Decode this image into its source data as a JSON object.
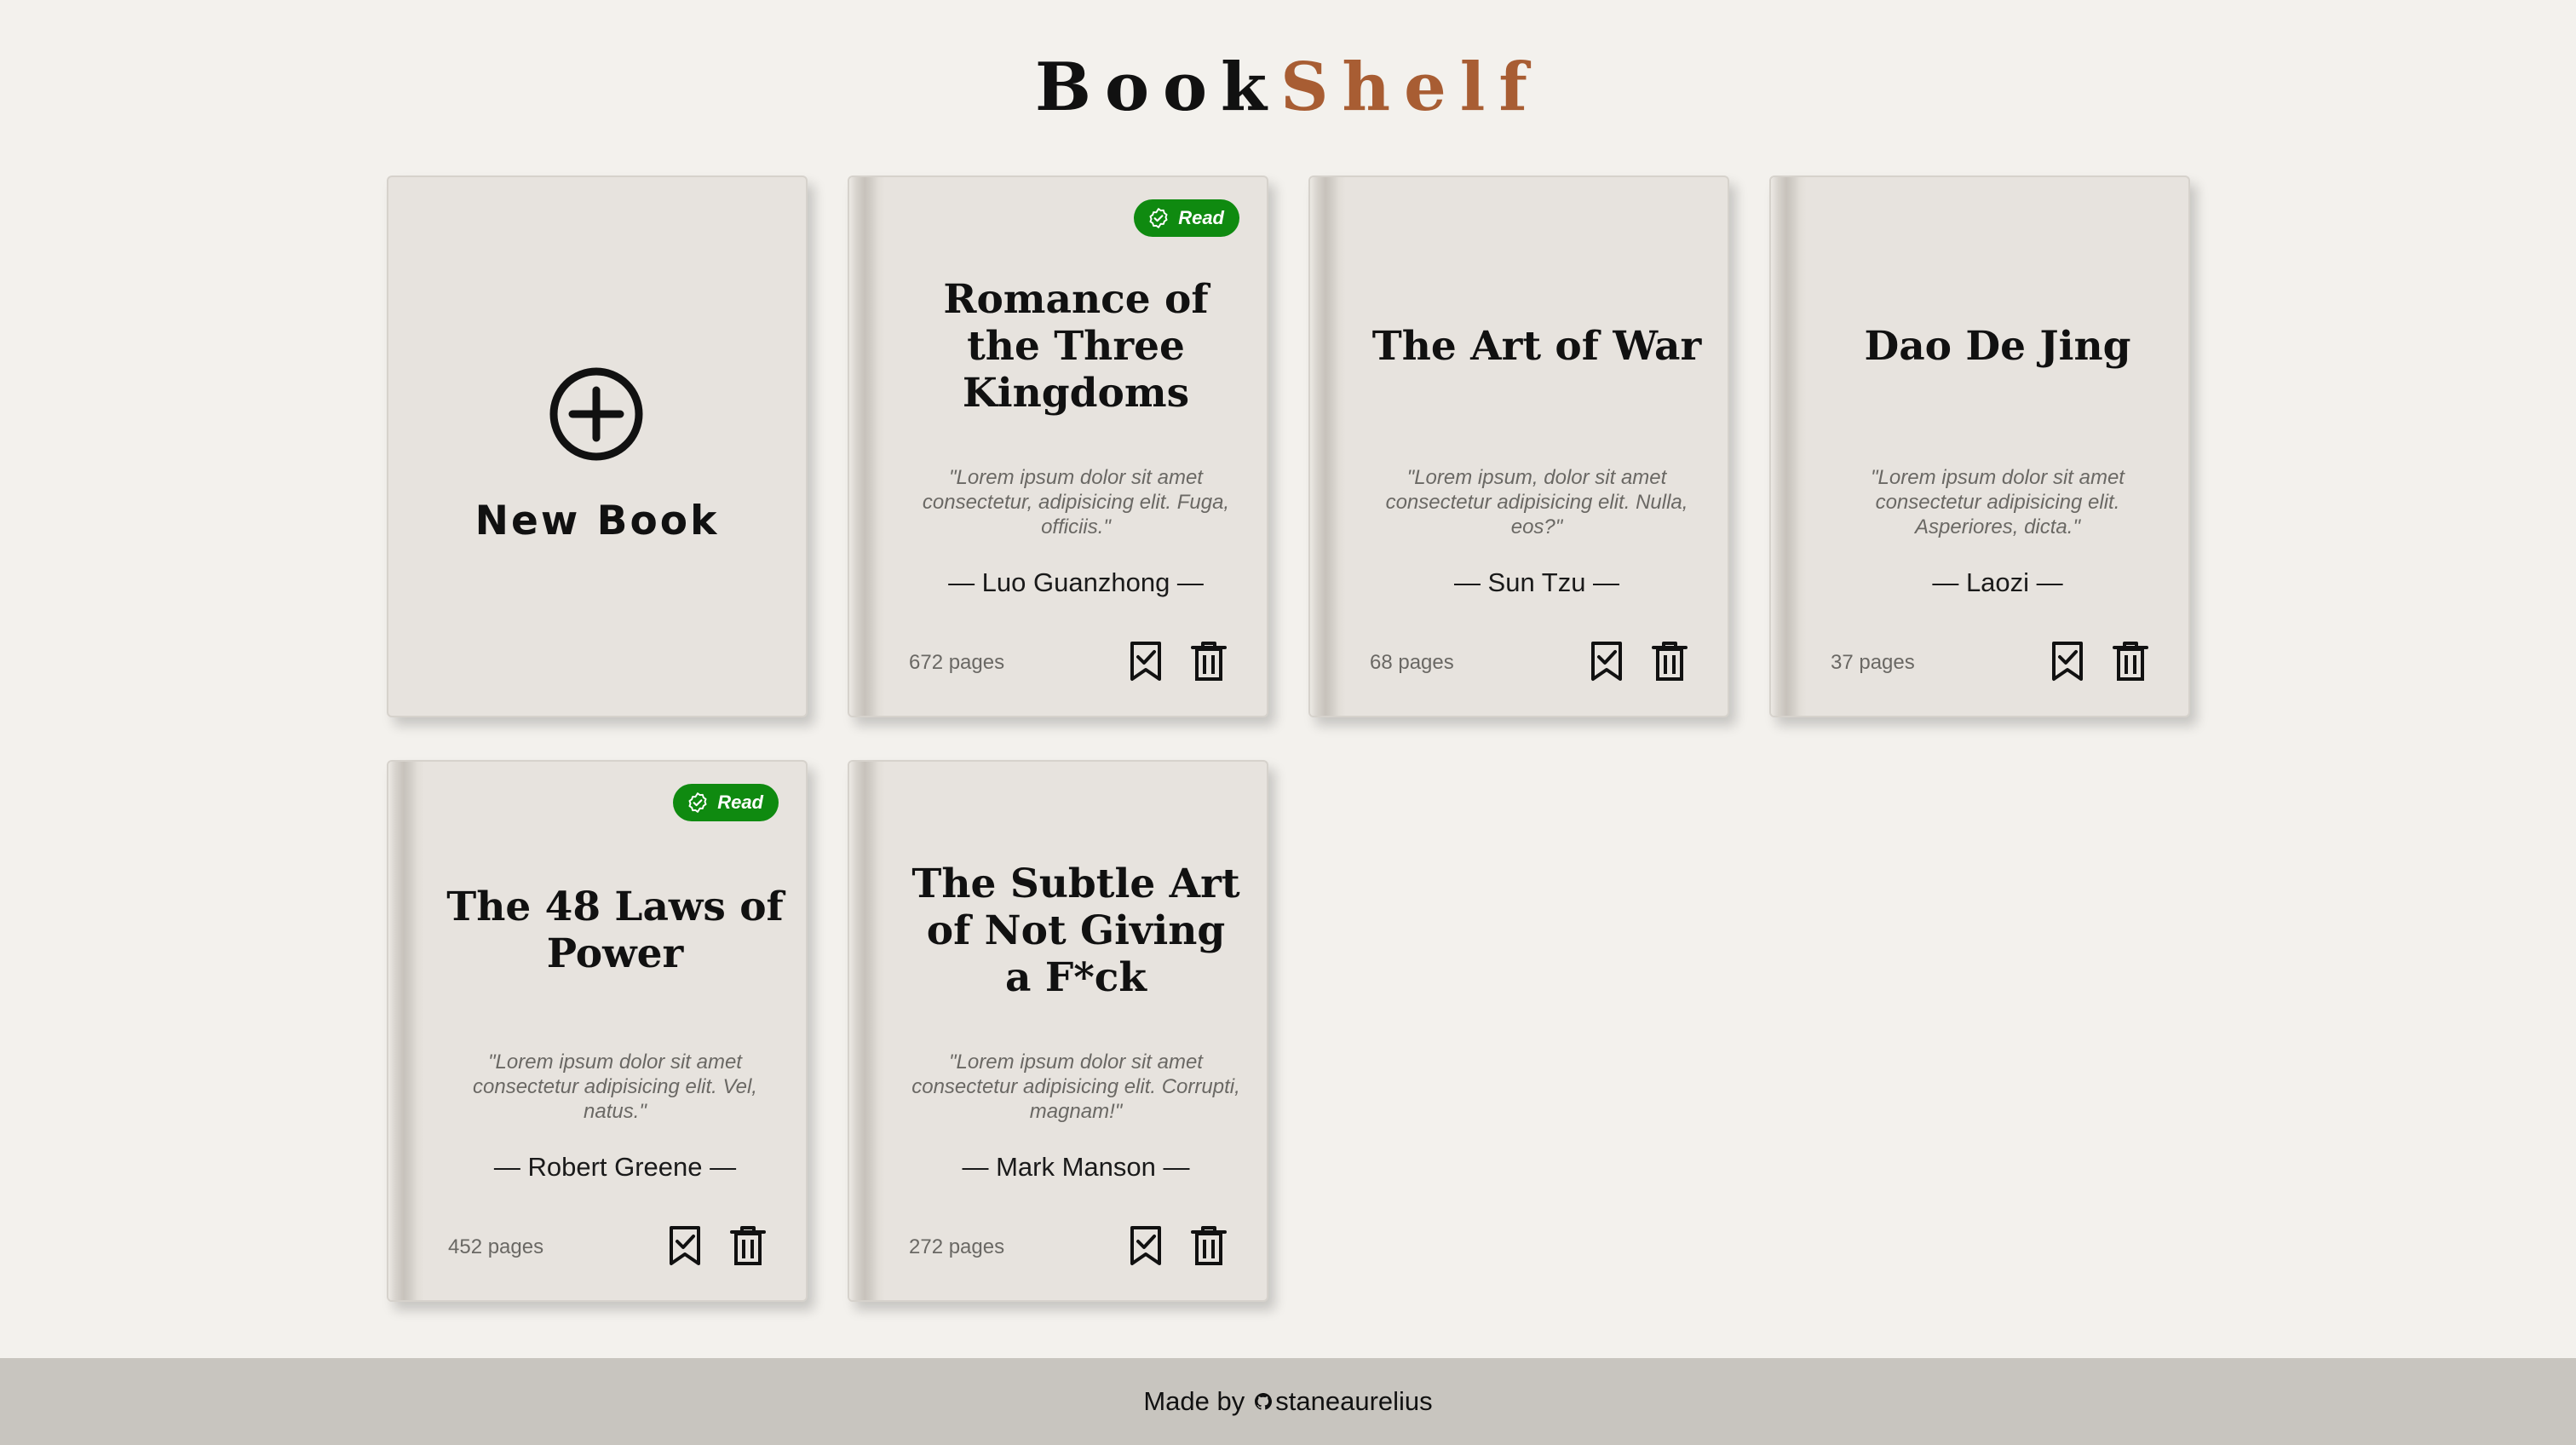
{
  "app": {
    "title_part1": "Book",
    "title_part2": "Shelf"
  },
  "new_book": {
    "label": "New Book",
    "icon": "plus-circle-icon"
  },
  "books": [
    {
      "title": "Romance of the Three Kingdoms",
      "quote": "\"Lorem ipsum dolor sit amet consectetur, adipisicing elit. Fuga, officiis.\"",
      "author": "— Luo Guanzhong —",
      "pages": "672 pages",
      "read": true
    },
    {
      "title": "The Art of War",
      "quote": "\"Lorem ipsum, dolor sit amet consectetur adipisicing elit. Nulla, eos?\"",
      "author": "— Sun Tzu —",
      "pages": "68 pages",
      "read": false
    },
    {
      "title": "Dao De Jing",
      "quote": "\"Lorem ipsum dolor sit amet consectetur adipisicing elit. Asperiores, dicta.\"",
      "author": "— Laozi —",
      "pages": "37 pages",
      "read": false
    },
    {
      "title": "The 48 Laws of Power",
      "quote": "\"Lorem ipsum dolor sit amet consectetur adipisicing elit. Vel, natus.\"",
      "author": "— Robert Greene —",
      "pages": "452 pages",
      "read": true
    },
    {
      "title": "The Subtle Art of Not Giving a F*ck",
      "quote": "\"Lorem ipsum dolor sit amet consectetur adipisicing elit. Corrupti, magnam!\"",
      "author": "— Mark Manson —",
      "pages": "272 pages",
      "read": false
    }
  ],
  "badge": {
    "read_label": "Read",
    "icon": "verified-check-icon"
  },
  "actions": {
    "mark_icon": "bookmark-check-icon",
    "delete_icon": "trash-icon"
  },
  "footer": {
    "prefix": "Made by",
    "username": "staneaurelius",
    "icon": "github-icon"
  },
  "colors": {
    "background": "#f3f1ed",
    "card": "#e7e3de",
    "accent": "#a85d33",
    "read_badge": "#0f8a10",
    "footer": "#c8c5bf"
  }
}
